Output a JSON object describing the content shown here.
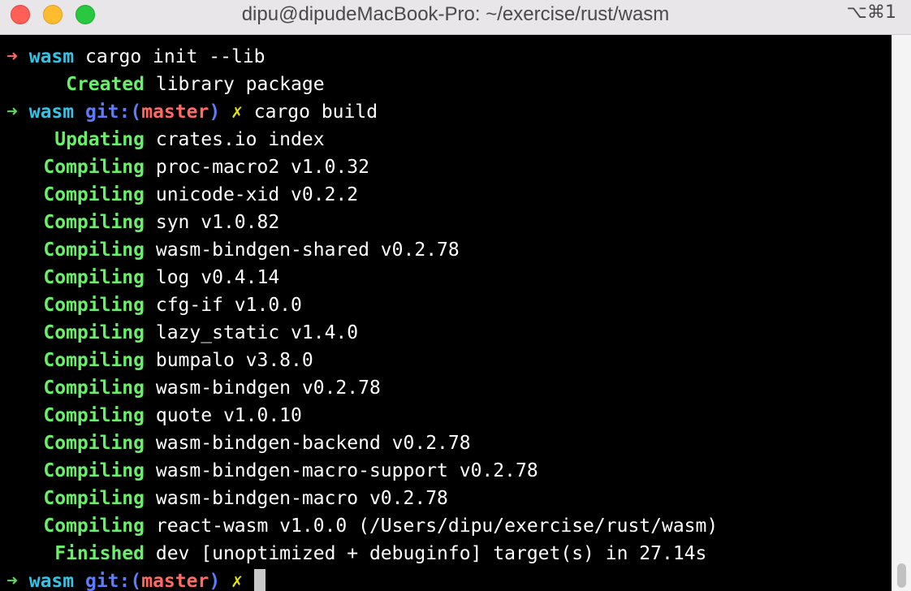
{
  "window": {
    "title": "dipu@dipudeMacBook-Pro: ~/exercise/rust/wasm",
    "shortcut": "⌥⌘1"
  },
  "terminal": {
    "prompt_arrow": "➜",
    "cwd": "wasm",
    "git_label": "git:(",
    "branch": "master",
    "git_close": ")",
    "dirty_mark": "✗",
    "commands": [
      "cargo init --lib",
      "cargo build"
    ],
    "output": [
      {
        "status": "Created",
        "text": "library package"
      },
      {
        "status": "Updating",
        "text": "crates.io index"
      },
      {
        "status": "Compiling",
        "text": "proc-macro2 v1.0.32"
      },
      {
        "status": "Compiling",
        "text": "unicode-xid v0.2.2"
      },
      {
        "status": "Compiling",
        "text": "syn v1.0.82"
      },
      {
        "status": "Compiling",
        "text": "wasm-bindgen-shared v0.2.78"
      },
      {
        "status": "Compiling",
        "text": "log v0.4.14"
      },
      {
        "status": "Compiling",
        "text": "cfg-if v1.0.0"
      },
      {
        "status": "Compiling",
        "text": "lazy_static v1.4.0"
      },
      {
        "status": "Compiling",
        "text": "bumpalo v3.8.0"
      },
      {
        "status": "Compiling",
        "text": "wasm-bindgen v0.2.78"
      },
      {
        "status": "Compiling",
        "text": "quote v1.0.10"
      },
      {
        "status": "Compiling",
        "text": "wasm-bindgen-backend v0.2.78"
      },
      {
        "status": "Compiling",
        "text": "wasm-bindgen-macro-support v0.2.78"
      },
      {
        "status": "Compiling",
        "text": "wasm-bindgen-macro v0.2.78"
      },
      {
        "status": "Compiling",
        "text": "react-wasm v1.0.0 (/Users/dipu/exercise/rust/wasm)"
      },
      {
        "status": "Finished",
        "text": "dev [unoptimized + debuginfo] target(s) in 27.14s"
      }
    ]
  },
  "colors": {
    "background": "#000000",
    "cwd": "#33c4e5",
    "status_green": "#69f069",
    "branch": "#ff6a66",
    "git": "#5c7cfa",
    "dirty": "#e5e500"
  },
  "icons": {
    "close": "close-traffic-light-icon",
    "minimize": "minimize-traffic-light-icon",
    "maximize": "maximize-traffic-light-icon"
  }
}
